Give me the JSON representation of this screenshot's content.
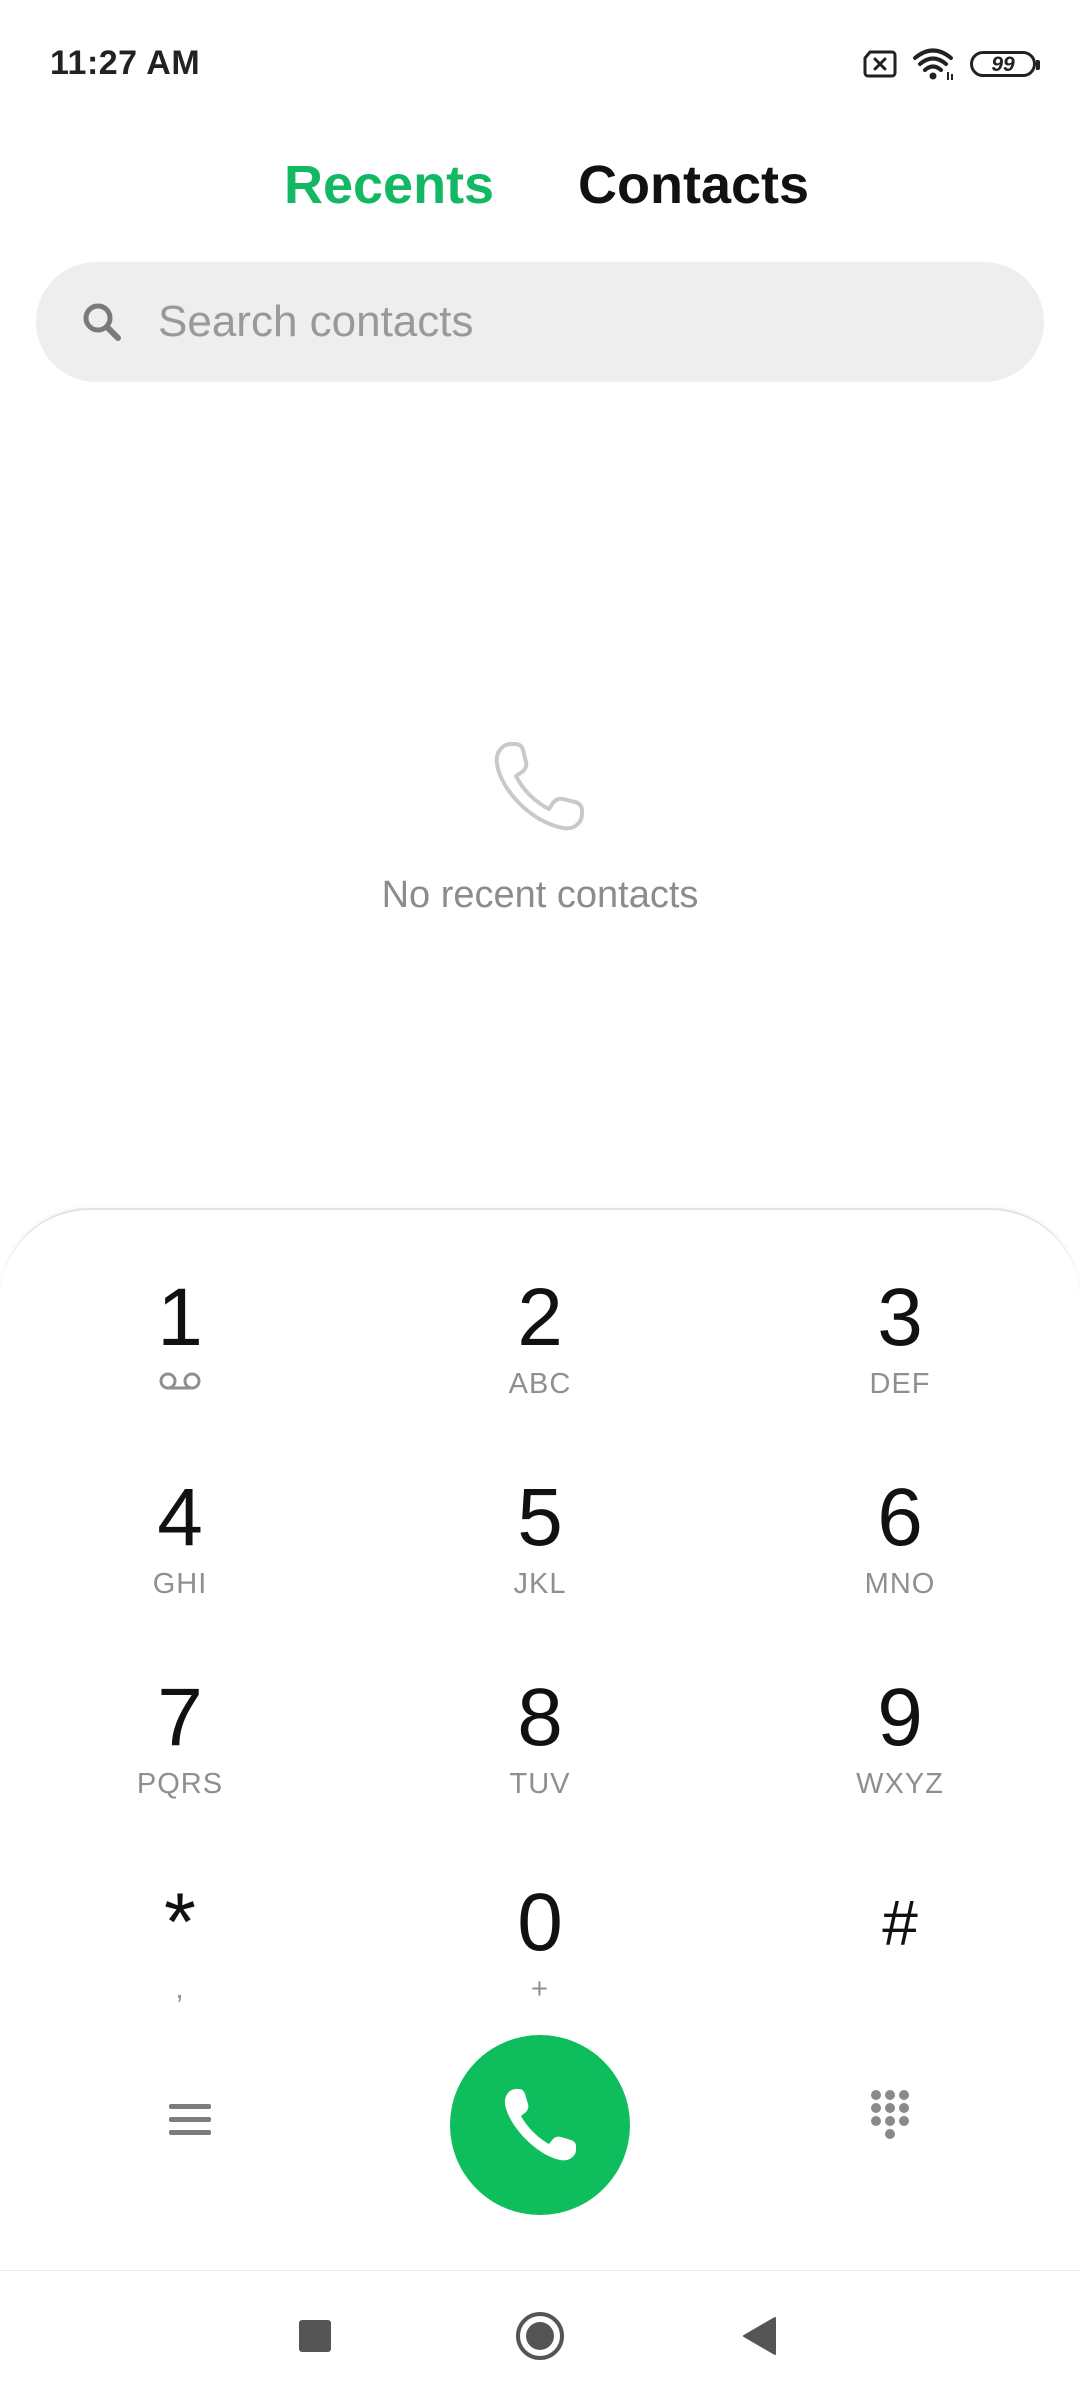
{
  "status_bar": {
    "time": "11:27 AM",
    "battery": "99",
    "icons": [
      "sim-missing-icon",
      "wifi-icon",
      "battery-icon"
    ]
  },
  "tabs": [
    {
      "label": "Recents",
      "active": true
    },
    {
      "label": "Contacts",
      "active": false
    }
  ],
  "search": {
    "placeholder": "Search contacts",
    "value": ""
  },
  "empty_state": {
    "icon": "phone-outline-icon",
    "message": "No recent contacts"
  },
  "dialpad": {
    "keys": [
      {
        "digit": "1",
        "letters": ""
      },
      {
        "digit": "2",
        "letters": "ABC"
      },
      {
        "digit": "3",
        "letters": "DEF"
      },
      {
        "digit": "4",
        "letters": "GHI"
      },
      {
        "digit": "5",
        "letters": "JKL"
      },
      {
        "digit": "6",
        "letters": "MNO"
      },
      {
        "digit": "7",
        "letters": "PQRS"
      },
      {
        "digit": "8",
        "letters": "TUV"
      },
      {
        "digit": "9",
        "letters": "WXYZ"
      },
      {
        "digit": "*",
        "letters": ","
      },
      {
        "digit": "0",
        "letters": "+"
      },
      {
        "digit": "#",
        "letters": ""
      }
    ],
    "actions": [
      "menu-icon",
      "phone-call-icon",
      "dialpad-icon"
    ]
  },
  "colors": {
    "accent": "#12b862",
    "call_button": "#0ebd5b",
    "search_bg": "#eeeeee",
    "muted_text": "#8c8c8c"
  },
  "nav_bar": {
    "icons": [
      "recents-square-icon",
      "home-circle-icon",
      "back-triangle-icon"
    ]
  }
}
